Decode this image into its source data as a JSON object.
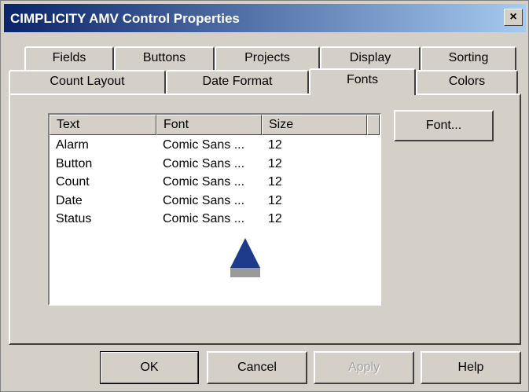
{
  "window": {
    "title": "CIMPLICITY AMV Control Properties",
    "close_glyph": "×"
  },
  "tabs_back": [
    {
      "label": "Fields"
    },
    {
      "label": "Buttons"
    },
    {
      "label": "Projects"
    },
    {
      "label": "Display"
    },
    {
      "label": "Sorting"
    }
  ],
  "tabs_front": [
    {
      "label": "Count Layout"
    },
    {
      "label": "Date Format"
    },
    {
      "label": "Fonts",
      "active": true
    },
    {
      "label": "Colors"
    }
  ],
  "list": {
    "columns": [
      "Text",
      "Font",
      "Size"
    ],
    "rows": [
      {
        "text": "Alarm",
        "font": "Comic Sans ...",
        "size": "12"
      },
      {
        "text": "Button",
        "font": "Comic Sans ...",
        "size": "12"
      },
      {
        "text": "Count",
        "font": "Comic Sans ...",
        "size": "12"
      },
      {
        "text": "Date",
        "font": "Comic Sans ...",
        "size": "12"
      },
      {
        "text": "Status",
        "font": "Comic Sans ...",
        "size": "12"
      }
    ]
  },
  "buttons": {
    "font": "Font...",
    "ok": "OK",
    "cancel": "Cancel",
    "apply": "Apply",
    "help": "Help"
  },
  "colors": {
    "titlebar_start": "#0a246a",
    "titlebar_end": "#a6caf0",
    "face": "#d4d0c8",
    "cursor": "#1e3a8a"
  }
}
